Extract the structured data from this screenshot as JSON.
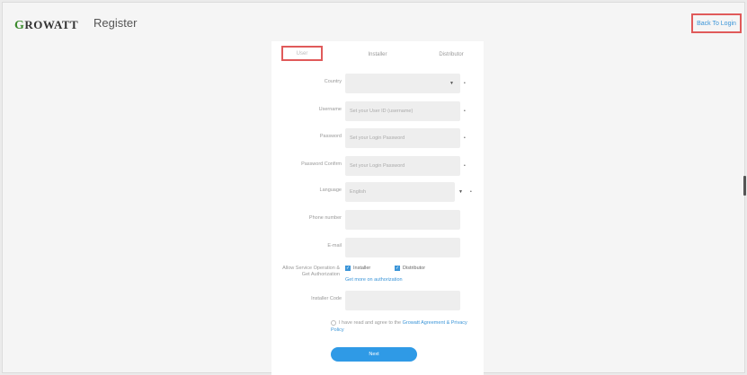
{
  "header": {
    "logo_first": "G",
    "logo_rest": "ROWATT",
    "title": "Register",
    "back_to_login": "Back To Login"
  },
  "tabs": [
    {
      "label": "User",
      "active": true
    },
    {
      "label": "Installer",
      "active": false
    },
    {
      "label": "Distributor",
      "active": false
    }
  ],
  "form": {
    "country": {
      "label": "Country",
      "value": ""
    },
    "account": {
      "label": "Username",
      "placeholder": "Set your User ID (username)"
    },
    "password": {
      "label": "Password",
      "placeholder": "Set your Login Password"
    },
    "confirm_password": {
      "label": "Password Confirm",
      "placeholder": "Set your Login Password"
    },
    "language": {
      "label": "Language",
      "value": "English"
    },
    "phone": {
      "label": "Phone number",
      "value": ""
    },
    "email": {
      "label": "E-mail",
      "value": ""
    },
    "service_question": "Allow Service Operation & Get Authorization",
    "checks": [
      {
        "label": "Installer",
        "checked": true
      },
      {
        "label": "Distributor",
        "checked": true
      }
    ],
    "learn_more": "Get more on authorization",
    "installer_code": {
      "label": "Installer Code",
      "value": ""
    },
    "agree_text": "I have read and agree to the",
    "agree_link": "Growatt Agreement",
    "agree_suffix": "& Privacy Policy",
    "next": "Next"
  },
  "colors": {
    "accent": "#2f9ae6",
    "highlight": "#e05a5a",
    "brand_green": "#3b8a2d"
  }
}
